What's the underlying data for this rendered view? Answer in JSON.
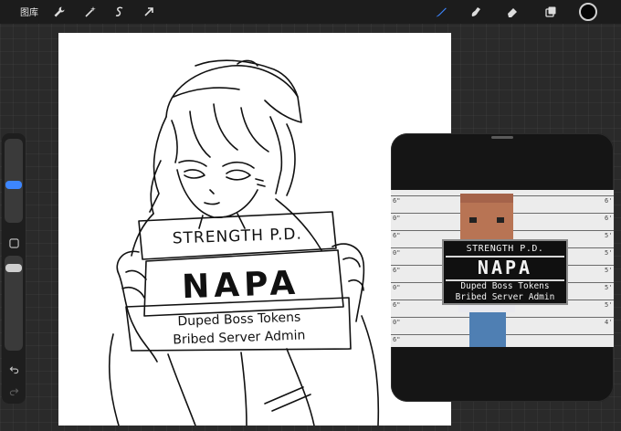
{
  "toolbar": {
    "gallery_label": "图库",
    "tools_left": [
      "wrench-icon",
      "magic-wand-icon",
      "selection-icon",
      "transform-arrow-icon"
    ],
    "tools_right": [
      "brush-icon",
      "smudge-icon",
      "eraser-icon",
      "layers-icon"
    ],
    "current_color": "#050505",
    "accent_color": "#3d86ff"
  },
  "sidebar": {
    "brush_size_level": 0.2,
    "opacity_level": 0.0
  },
  "sketch_sign": {
    "header": "STRENGTH P.D.",
    "name": "NAPA",
    "line1": "Duped Boss Tokens",
    "line2": "Bribed Server Admin"
  },
  "mugshot_sign": {
    "header": "STRENGTH P.D.",
    "name": "NAPA",
    "line1": "Duped Boss Tokens",
    "line2": "Bribed Server Admin"
  },
  "height_chart": {
    "left_marks": [
      "6\"",
      "0\"",
      "6\"",
      "0\"",
      "6\"",
      "0\"",
      "6\"",
      "0\"",
      "6\""
    ],
    "right_marks": [
      "6'",
      "6'",
      "5'",
      "5'",
      "5'",
      "5'",
      "5'",
      "4'"
    ]
  }
}
